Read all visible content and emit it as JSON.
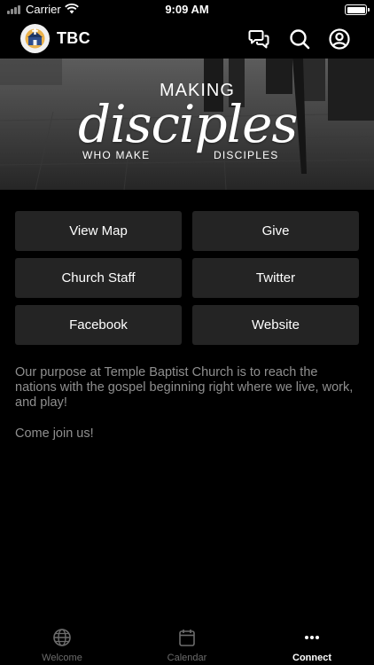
{
  "status_bar": {
    "carrier": "Carrier",
    "time": "9:09 AM"
  },
  "nav": {
    "title": "TBC",
    "icons": [
      "chat-icon",
      "search-icon",
      "account-icon"
    ]
  },
  "hero": {
    "line_top": "MAKING",
    "line_main": "disciples",
    "line_sub_left": "WHO MAKE",
    "line_sub_right": "DISCIPLES"
  },
  "buttons": [
    {
      "label": "View Map"
    },
    {
      "label": "Give"
    },
    {
      "label": "Church Staff"
    },
    {
      "label": "Twitter"
    },
    {
      "label": "Facebook"
    },
    {
      "label": "Website"
    }
  ],
  "description": {
    "paragraph": "Our purpose at Temple Baptist Church is to reach the nations with the gospel beginning right where we live, work, and play!",
    "closing": "Come join us!"
  },
  "tabs": [
    {
      "label": "Welcome",
      "icon": "globe-icon",
      "active": false
    },
    {
      "label": "Calendar",
      "icon": "calendar-icon",
      "active": false
    },
    {
      "label": "Connect",
      "icon": "more-icon",
      "active": true
    }
  ],
  "colors": {
    "background": "#000000",
    "button": "#242424",
    "text_muted": "#8f8f8f",
    "tab_inactive": "#6c6c6c"
  }
}
